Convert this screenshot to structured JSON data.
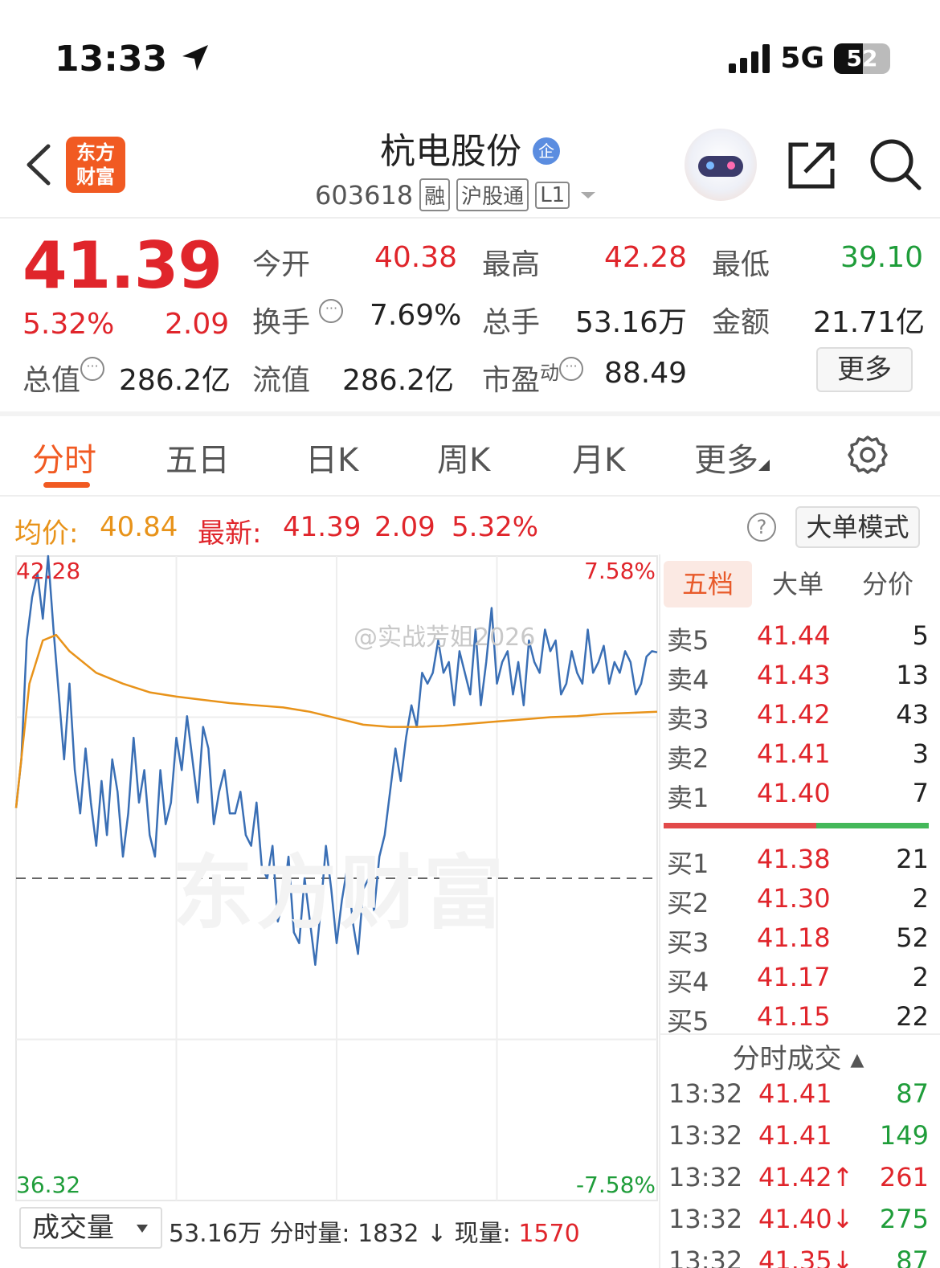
{
  "status": {
    "time": "13:33",
    "network": "5G",
    "battery": "52",
    "battery_level": 0.52
  },
  "header": {
    "brand_line1": "东方",
    "brand_line2": "财富",
    "stock_name": "杭电股份",
    "badge": "企",
    "stock_code": "603618",
    "tags": [
      "融",
      "沪股通",
      "L1"
    ]
  },
  "quote": {
    "price": "41.39",
    "change_pct": "5.32%",
    "change": "2.09",
    "open_label": "今开",
    "open": "40.38",
    "high_label": "最高",
    "high": "42.28",
    "low_label": "最低",
    "low": "39.10",
    "turnover_label": "换手",
    "turnover": "7.69%",
    "volume_label": "总手",
    "volume": "53.16万",
    "amount_label": "金额",
    "amount": "21.71亿",
    "mcap_label": "总值",
    "mcap": "286.2亿",
    "float_label": "流值",
    "float": "286.2亿",
    "pe_label": "市盈",
    "pe_sup": "动",
    "pe": "88.49",
    "more_button": "更多"
  },
  "tabs": [
    "分时",
    "五日",
    "日K",
    "周K",
    "月K",
    "更多"
  ],
  "info_row": {
    "avg_label": "均价:",
    "avg": "40.84",
    "latest_label": "最新:",
    "latest": "41.39",
    "change": "2.09",
    "change_pct": "5.32%",
    "big_order_button": "大单模式"
  },
  "chart_data": {
    "type": "line",
    "ylim": [
      36.32,
      42.28
    ],
    "y_top_label": "42.28",
    "y_bottom_label": "36.32",
    "pct_top_label": "7.58%",
    "pct_bottom_label": "-7.58%",
    "prev_close": 39.3,
    "x_range": [
      0,
      240
    ],
    "series": [
      {
        "color": "#3a6fb5",
        "x": [
          0,
          2,
          4,
          6,
          8,
          10,
          12,
          14,
          16,
          18,
          20,
          22,
          24,
          26,
          28,
          30,
          32,
          34,
          36,
          38,
          40,
          42,
          44,
          46,
          48,
          50,
          52,
          54,
          56,
          58,
          60,
          62,
          64,
          66,
          68,
          70,
          72,
          74,
          76,
          78,
          80,
          82,
          84,
          86,
          88,
          90,
          92,
          94,
          96,
          98,
          100,
          102,
          104,
          106,
          108,
          110,
          112,
          114,
          116,
          118,
          120,
          122,
          124,
          126,
          128,
          130,
          132,
          134,
          136,
          138,
          140,
          142,
          144,
          146,
          148,
          150,
          152,
          154,
          156,
          158,
          160,
          162,
          164,
          166,
          168,
          170,
          172,
          174,
          176,
          178,
          180,
          182,
          184,
          186,
          188,
          190,
          192,
          194,
          196,
          198,
          200,
          202,
          204,
          206,
          208,
          210,
          212,
          214,
          216,
          218,
          220,
          222,
          224,
          226,
          228,
          230,
          232,
          234,
          236,
          238,
          240
        ],
        "y": [
          39.95,
          40.4,
          41.5,
          41.9,
          42.12,
          41.7,
          42.28,
          41.6,
          41.0,
          40.4,
          41.1,
          40.3,
          39.9,
          40.5,
          40.0,
          39.6,
          40.2,
          39.7,
          40.4,
          40.1,
          39.5,
          39.9,
          40.6,
          40.0,
          40.3,
          39.7,
          39.5,
          40.3,
          39.8,
          40.0,
          40.6,
          40.3,
          40.8,
          40.4,
          40.0,
          40.7,
          40.5,
          39.8,
          40.1,
          40.3,
          39.9,
          39.9,
          40.1,
          39.7,
          39.6,
          40.0,
          39.4,
          39.3,
          39.6,
          38.9,
          39.1,
          39.5,
          38.8,
          38.7,
          39.3,
          38.9,
          38.5,
          39.0,
          39.6,
          39.2,
          38.7,
          39.1,
          39.4,
          38.9,
          38.6,
          39.2,
          39.3,
          39.0,
          39.5,
          39.7,
          40.1,
          40.5,
          40.2,
          40.6,
          40.9,
          40.7,
          41.2,
          41.1,
          41.2,
          41.5,
          41.2,
          41.3,
          40.9,
          41.4,
          41.2,
          41.0,
          41.6,
          40.9,
          41.3,
          41.8,
          41.1,
          41.3,
          41.4,
          41.0,
          41.3,
          40.9,
          41.5,
          41.3,
          41.2,
          41.6,
          41.4,
          41.5,
          41.0,
          41.1,
          41.4,
          41.2,
          41.1,
          41.6,
          41.2,
          41.3,
          41.45,
          41.1,
          41.3,
          41.2,
          41.4,
          41.3,
          41.0,
          41.1,
          41.35,
          41.4,
          41.39
        ]
      },
      {
        "color": "#e8931a",
        "x": [
          0,
          5,
          10,
          15,
          20,
          30,
          40,
          50,
          60,
          70,
          80,
          90,
          100,
          110,
          120,
          130,
          140,
          150,
          160,
          170,
          180,
          190,
          200,
          210,
          220,
          230,
          240
        ],
        "y": [
          39.95,
          41.1,
          41.5,
          41.55,
          41.4,
          41.2,
          41.1,
          41.02,
          40.98,
          40.95,
          40.92,
          40.9,
          40.88,
          40.84,
          40.78,
          40.72,
          40.7,
          40.7,
          40.71,
          40.73,
          40.75,
          40.77,
          40.79,
          40.8,
          40.82,
          40.83,
          40.84
        ]
      }
    ]
  },
  "order_book": {
    "tabs": [
      "五档",
      "大单",
      "分价"
    ],
    "asks": [
      {
        "label": "卖5",
        "price": "41.44",
        "vol": "5"
      },
      {
        "label": "卖4",
        "price": "41.43",
        "vol": "13"
      },
      {
        "label": "卖3",
        "price": "41.42",
        "vol": "43"
      },
      {
        "label": "卖2",
        "price": "41.41",
        "vol": "3"
      },
      {
        "label": "卖1",
        "price": "41.40",
        "vol": "7"
      }
    ],
    "bids": [
      {
        "label": "买1",
        "price": "41.38",
        "vol": "21"
      },
      {
        "label": "买2",
        "price": "41.30",
        "vol": "2"
      },
      {
        "label": "买3",
        "price": "41.18",
        "vol": "52"
      },
      {
        "label": "买4",
        "price": "41.17",
        "vol": "2"
      },
      {
        "label": "买5",
        "price": "41.15",
        "vol": "22"
      }
    ],
    "trades_header": "分时成交 ▴",
    "trades": [
      {
        "time": "13:32",
        "price": "41.41",
        "vol": "87"
      },
      {
        "time": "13:32",
        "price": "41.41",
        "vol": "149"
      },
      {
        "time": "13:32",
        "price": "41.42↑",
        "vol": "261"
      },
      {
        "time": "13:32",
        "price": "41.40↓",
        "vol": "275"
      },
      {
        "time": "13:32",
        "price": "41.35↓",
        "vol": "87"
      }
    ]
  },
  "volume_bar": {
    "select_label": "成交量",
    "total": "53.16万",
    "minute_label": "分时量:",
    "minute_value": "1832 ↓",
    "current_label": "现量:",
    "current_value": "1570"
  },
  "watermark": {
    "text": "@实战芳姐2026",
    "logo_text": "东方财富"
  },
  "colors": {
    "up": "#e0252b",
    "down": "#1f9d3a",
    "accent": "#f15a22",
    "avg_line": "#e8931a",
    "price_line": "#3a6fb5"
  }
}
